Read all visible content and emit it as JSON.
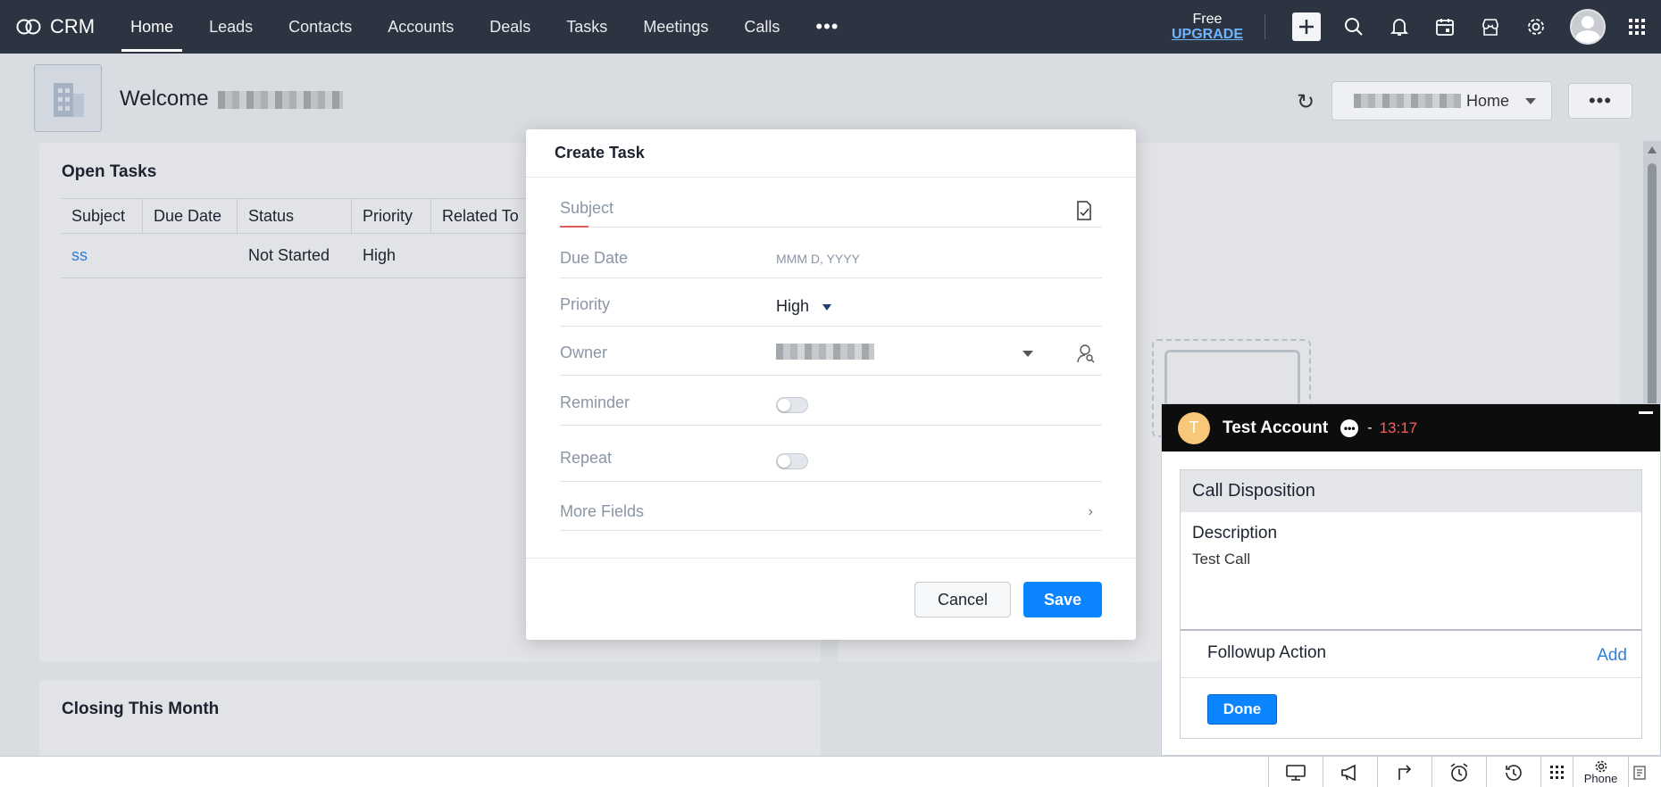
{
  "app": {
    "name": "CRM"
  },
  "nav": {
    "items": [
      {
        "label": "Home",
        "active": true
      },
      {
        "label": "Leads"
      },
      {
        "label": "Contacts"
      },
      {
        "label": "Accounts"
      },
      {
        "label": "Deals"
      },
      {
        "label": "Tasks"
      },
      {
        "label": "Meetings"
      },
      {
        "label": "Calls"
      }
    ],
    "more": "•••"
  },
  "upgrade": {
    "free": "Free",
    "upgrade": "UPGRADE"
  },
  "header": {
    "welcome": "Welcome",
    "home_dropdown": "Home"
  },
  "open_tasks": {
    "title": "Open Tasks",
    "columns": [
      "Subject",
      "Due Date",
      "Status",
      "Priority",
      "Related To"
    ],
    "rows": [
      {
        "subject": "ss",
        "due_date": "",
        "status": "Not Started",
        "priority": "High",
        "related_to": ""
      }
    ]
  },
  "closing": {
    "title": "Closing This Month"
  },
  "modal": {
    "title": "Create Task",
    "subject_label": "Subject",
    "due_date_label": "Due Date",
    "due_date_placeholder": "MMM D, YYYY",
    "priority_label": "Priority",
    "priority_value": "High",
    "owner_label": "Owner",
    "reminder_label": "Reminder",
    "reminder_on": false,
    "repeat_label": "Repeat",
    "repeat_on": false,
    "more_fields_label": "More Fields",
    "cancel": "Cancel",
    "save": "Save"
  },
  "call_panel": {
    "avatar_letter": "T",
    "name": "Test Account",
    "dash": "-",
    "timer": "13:17",
    "disposition_title": "Call Disposition",
    "description_label": "Description",
    "description_value": "Test Call",
    "followup_label": "Followup Action",
    "add_label": "Add",
    "done_label": "Done"
  },
  "bottombar": {
    "phone_label": "Phone"
  },
  "colors": {
    "topbar": "#2d3441",
    "accent": "#0a84ff",
    "link": "#2f7fd8",
    "timer": "#ff5c5c"
  }
}
